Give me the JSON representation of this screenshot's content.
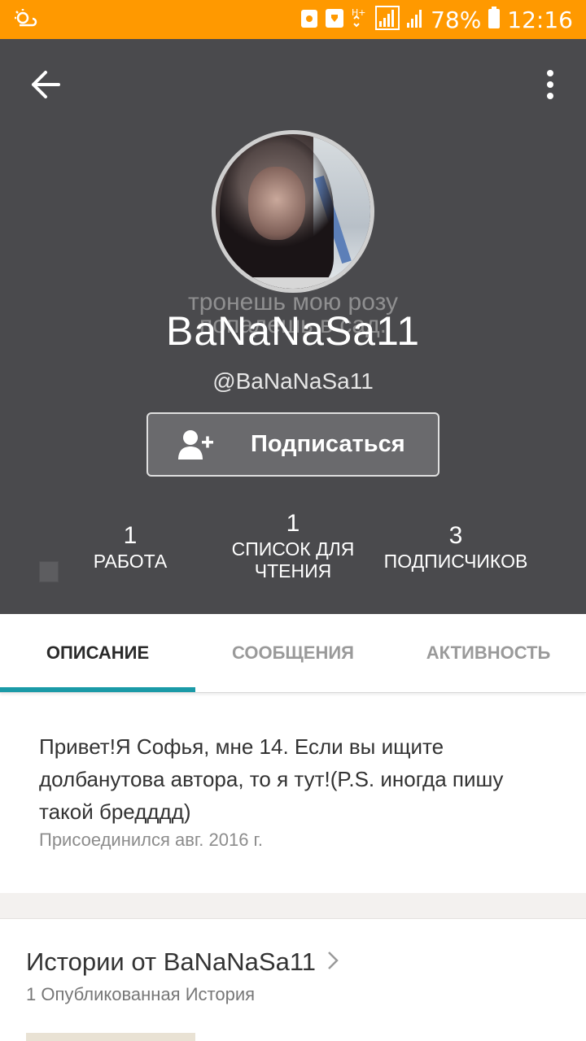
{
  "status_bar": {
    "battery": "78%",
    "time": "12:16",
    "network": "H+",
    "colors": {
      "background": "#ff9900"
    }
  },
  "header": {
    "background": "#4a4a4d",
    "avatar_caption": "тронешь мою розу\nпопадешь в сад.",
    "username": "BaNaNaSa11",
    "handle": "@BaNaNaSa11",
    "follow_label": "Подписаться",
    "stats": {
      "works": {
        "count": "1",
        "label": "РАБОТА"
      },
      "reading": {
        "count": "1",
        "label": "СПИСОК ДЛЯ ЧТЕНИЯ"
      },
      "followers": {
        "count": "3",
        "label": "ПОДПИСЧИКОВ"
      }
    }
  },
  "tabs": [
    {
      "label": "ОПИСАНИЕ",
      "active": true
    },
    {
      "label": "СООБЩЕНИЯ",
      "active": false
    },
    {
      "label": "АКТИВНОСТЬ",
      "active": false
    }
  ],
  "about": {
    "description": "Привет!Я Софья, мне 14. Если вы ищите долбанутова автора, то я тут!(P.S. иногда пишу такой бредддд)",
    "joined": "Присоединился авг. 2016 г."
  },
  "stories": {
    "title": "Истории от BaNaNaSa11",
    "subtitle": "1 Опубликованная История"
  },
  "icons": {
    "back": "arrow-left-icon",
    "menu": "more-vert-icon",
    "follow": "add-user-icon",
    "chevron": "chevron-right-icon"
  },
  "accent_color": "#1a9aa7"
}
